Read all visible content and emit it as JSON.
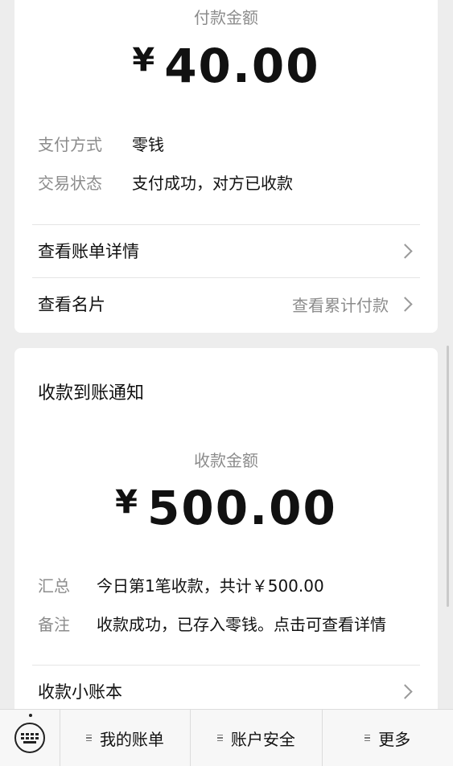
{
  "payment_card": {
    "amount_label": "付款金额",
    "currency": "¥",
    "amount": "40.00",
    "method_key": "支付方式",
    "method_value": "零钱",
    "status_key": "交易状态",
    "status_value": "支付成功，对方已收款",
    "bill_details_label": "查看账单详情",
    "card_label": "查看名片",
    "card_extra": "查看累计付款"
  },
  "receipt_card": {
    "title": "收款到账通知",
    "amount_label": "收款金额",
    "currency": "¥",
    "amount": "500.00",
    "summary_key": "汇总",
    "summary_value": "今日第1笔收款，共计￥500.00",
    "note_key": "备注",
    "note_value": "收款成功，已存入零钱。点击可查看详情",
    "ledger_label": "收款小账本"
  },
  "bottom_menu": {
    "keyboard_icon": "keyboard-icon",
    "items": [
      "我的账单",
      "账户安全",
      "更多"
    ]
  }
}
